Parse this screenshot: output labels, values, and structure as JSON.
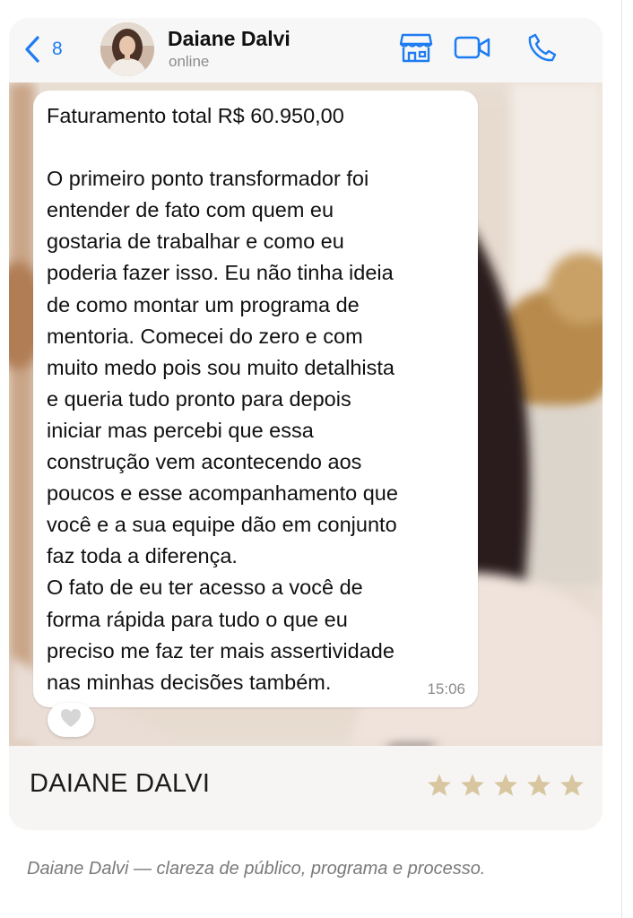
{
  "chat": {
    "back_count": "8",
    "contact_name": "Daiane Dalvi",
    "contact_status": "online",
    "icons": {
      "back": "chevron-left-icon",
      "store": "store-icon",
      "video": "video-camera-icon",
      "call": "phone-icon"
    },
    "accent_color": "#1e7cf2"
  },
  "message": {
    "text": "Faturamento total R$ 60.950,00\n\nO primeiro ponto transformador foi\nentender de fato com quem eu\ngostaria de trabalhar e como eu\npoderia fazer isso. Eu não tinha ideia\nde como montar um programa de\nmentoria. Comecei do zero e com\nmuito medo pois sou muito detalhista\ne queria tudo pronto para depois\niniciar mas percebi que essa\nconstrução vem acontecendo aos\npoucos e esse acompanhamento que\nvocê e a sua equipe dão em conjunto\nfaz toda a diferença.\nO fato de eu ter acesso a você de\nforma rápida para tudo o que eu\npreciso me faz ter mais assertividade\nnas minhas decisões também.",
    "time": "15:06",
    "reaction_icon": "heart-icon"
  },
  "testimonial": {
    "name": "DAIANE DALVI",
    "rating": 5,
    "rating_max": 5,
    "star_color": "#d8c6a0",
    "caption": "Daiane Dalvi — clareza de público, programa e processo."
  }
}
